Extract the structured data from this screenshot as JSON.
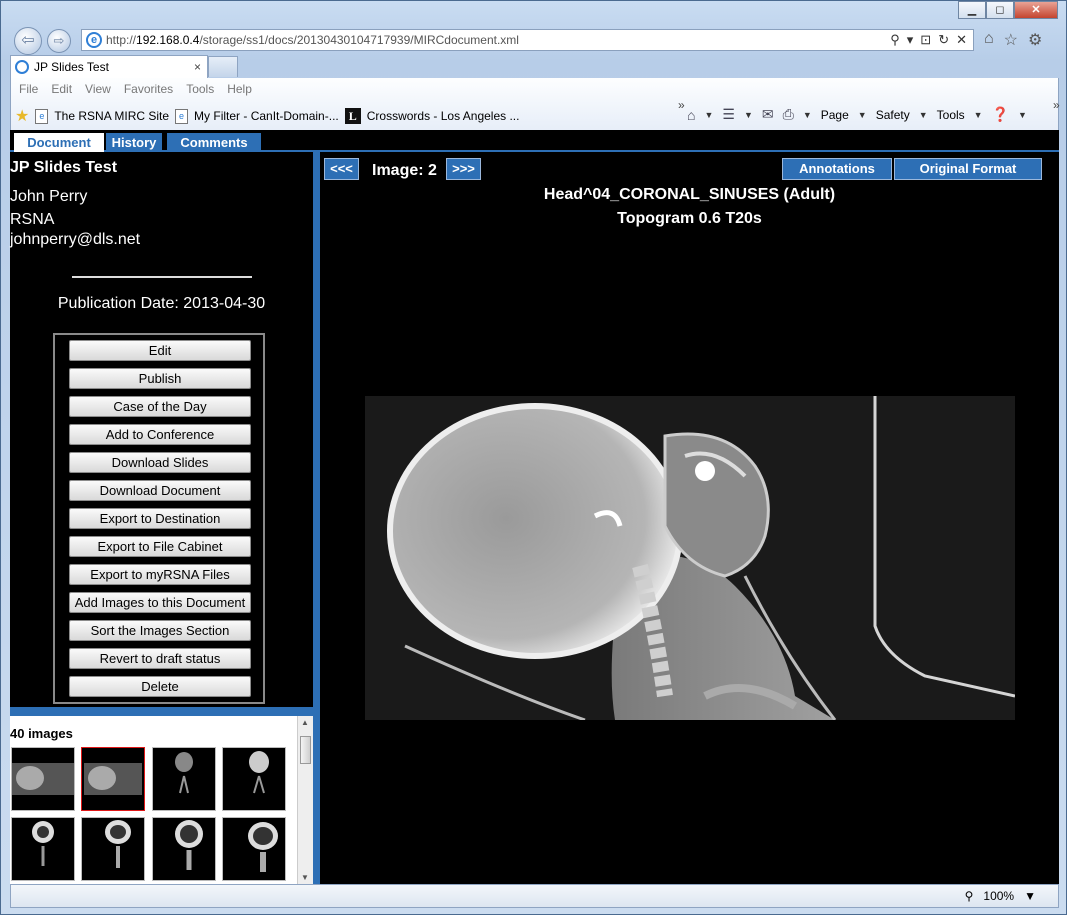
{
  "browser": {
    "url_prefix": "http://",
    "url_host": "192.168.0.4",
    "url_path": "/storage/ss1/docs/20130430104717939/MIRCdocument.xml",
    "tab_title": "JP Slides Test",
    "tab_close": "×",
    "menu": [
      "File",
      "Edit",
      "View",
      "Favorites",
      "Tools",
      "Help"
    ],
    "favorites": [
      "The RSNA MIRC Site",
      "My Filter - CanIt-Domain-...",
      "Crosswords - Los Angeles ..."
    ],
    "commands": {
      "page": "Page",
      "safety": "Safety",
      "tools": "Tools"
    },
    "chevron": "»",
    "zoom": "100%"
  },
  "doc_tabs": [
    "Document",
    "History",
    "Comments"
  ],
  "left": {
    "title": "JP Slides Test",
    "author": "John Perry",
    "affiliation": "RSNA",
    "email": "johnperry@dls.net",
    "publication_date": "Publication Date: 2013-04-30",
    "actions": [
      "Edit",
      "Publish",
      "Case of the Day",
      "Add to Conference",
      "Download Slides",
      "Download Document",
      "Export to Destination",
      "Export to File Cabinet",
      "Export to myRSNA Files",
      "Add Images to this Document",
      "Sort the Images Section",
      "Revert to draft status",
      "Delete"
    ],
    "image_count": "40 images"
  },
  "viewer": {
    "prev": "<<<",
    "next": ">>>",
    "image_label": "Image: 2",
    "annotations": "Annotations",
    "original_format": "Original Format",
    "series_title": "Head^04_CORONAL_SINUSES (Adult)",
    "series_sub": "Topogram  0.6  T20s"
  },
  "colors": {
    "accent": "#2d6fb5",
    "selected_thumb": "#e01818"
  }
}
